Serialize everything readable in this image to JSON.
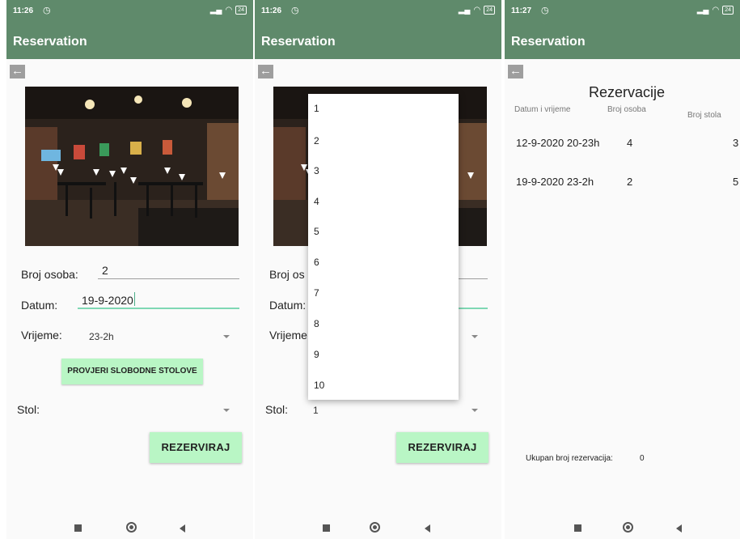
{
  "screen1": {
    "status": {
      "time": "11:26",
      "alarm_icon": "alarm-clock-icon",
      "battery": "24"
    },
    "appbar": {
      "title": "Reservation"
    },
    "back_icon": "arrow-left-icon",
    "form": {
      "persons_label": "Broj osoba:",
      "persons_value": "2",
      "date_label": "Datum:",
      "date_value": "19-9-2020",
      "time_label": "Vrijeme:",
      "time_value": "23-2h",
      "check_button": "PROVJERI SLOBODNE STOLOVE",
      "table_label": "Stol:",
      "table_value": "",
      "reserve_button": "REZERVIRAJ"
    }
  },
  "screen2": {
    "status": {
      "time": "11:26",
      "alarm_icon": "alarm-clock-icon",
      "battery": "24"
    },
    "appbar": {
      "title": "Reservation"
    },
    "back_icon": "arrow-left-icon",
    "form": {
      "persons_label": "Broj os",
      "date_label": "Datum:",
      "time_label": "Vrijeme",
      "table_label": "Stol:",
      "table_value": "1",
      "reserve_button": "REZERVIRAJ"
    },
    "dropdown_options": [
      "1",
      "2",
      "3",
      "4",
      "5",
      "6",
      "7",
      "8",
      "9",
      "10"
    ]
  },
  "screen3": {
    "status": {
      "time": "11:27",
      "alarm_icon": "alarm-clock-icon",
      "battery": "24"
    },
    "appbar": {
      "title": "Reservation"
    },
    "back_icon": "arrow-left-icon",
    "title": "Rezervacije",
    "columns": [
      "Datum i vrijeme",
      "Broj osoba",
      "Broj stola"
    ],
    "rows": [
      {
        "datetime": "12-9-2020 20-23h",
        "persons": "4",
        "table": "3"
      },
      {
        "datetime": "19-9-2020 23-2h",
        "persons": "2",
        "table": "5"
      }
    ],
    "total_label": "Ukupan broj rezervacija:",
    "total_value": "0"
  },
  "colors": {
    "primary": "#5f8a6b",
    "button": "#b9f6c5",
    "accent_line": "#7fd8b4"
  }
}
